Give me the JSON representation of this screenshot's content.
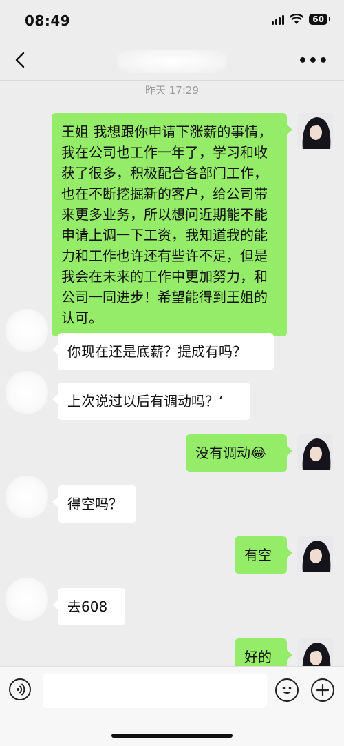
{
  "status_bar": {
    "time": "08:49",
    "battery": "60"
  },
  "nav": {
    "back_icon": "chevron-left-icon",
    "more_label": "•••"
  },
  "timestamp": "昨天 17:29",
  "messages": [
    {
      "side": "right",
      "text": "王姐 我想跟你申请下涨薪的事情，我在公司也工作一年了，学习和收获了很多，积极配合各部门工作，也在不断挖掘新的客户，给公司带来更多业务，所以想问近期能不能申请上调一下工资，我知道我的能力和工作也许还有些许不足，但是我会在未来的工作中更加努力，和公司一同进步！希望能得到王姐的认可。"
    },
    {
      "side": "left",
      "text": "你现在还是底薪？提成有吗？"
    },
    {
      "side": "left",
      "text": "上次说过以后有调动吗？‘"
    },
    {
      "side": "right",
      "text": "没有调动",
      "emoji": "😂"
    },
    {
      "side": "left",
      "text": "得空吗？"
    },
    {
      "side": "right",
      "text": "有空"
    },
    {
      "side": "left",
      "text": "去608"
    },
    {
      "side": "right",
      "text": "好的"
    }
  ],
  "input_bar": {
    "input_value": ""
  }
}
